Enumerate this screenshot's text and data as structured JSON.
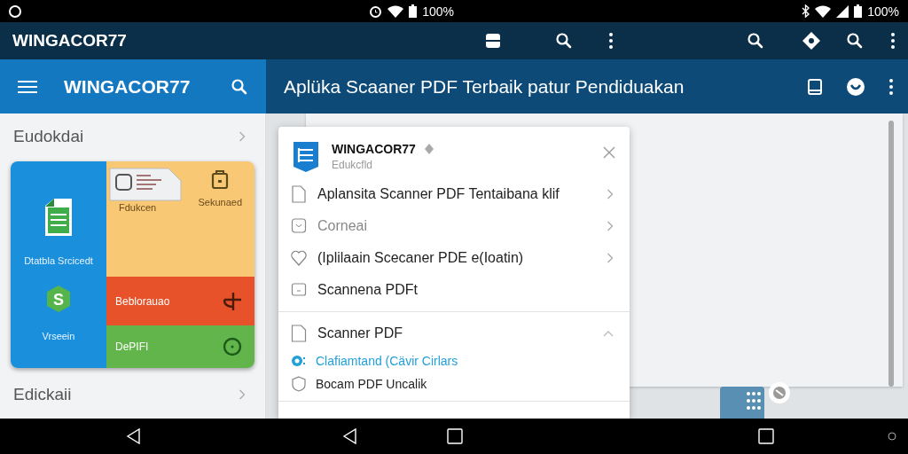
{
  "status_bar": {
    "readings": [
      "100%",
      "100%"
    ]
  },
  "app_bar": {
    "title": "WINGACOR77"
  },
  "toolbar": {
    "drawer_title": "WINGACOR77",
    "page_title": "Aplüka Scaaner PDF Terbaik patur Pendiduakan"
  },
  "sidebar": {
    "sections": [
      {
        "label": "Eudokdai"
      },
      {
        "label": "Edickaii"
      }
    ],
    "tile_card": {
      "left": {
        "color": "#1a8fdc",
        "labels": [
          "Dtatbla Srcicedt",
          "Vrseein"
        ],
        "badge": "S"
      },
      "tiles": [
        {
          "kind": "folder",
          "color": "#f9c874",
          "labels": [
            "Fdukcen",
            "Sekunaed"
          ]
        },
        {
          "kind": "plus",
          "color": "#e8522a",
          "labels": [
            "Beblorauao"
          ]
        },
        {
          "kind": "clock",
          "color": "#62b54a",
          "labels": [
            "DePIFI"
          ]
        }
      ]
    }
  },
  "dialog": {
    "title": "WINGACOR77",
    "subtitle": "Edukcfld",
    "items": [
      {
        "label": "Aplansita Scanner PDF Tentaibana klif",
        "disabled": false
      },
      {
        "label": "Corneai",
        "disabled": true
      },
      {
        "label": "(Iplilaain Scecaner PDE e(Ioatin)",
        "disabled": false
      },
      {
        "label": "Scannena PDFt",
        "disabled": false
      }
    ],
    "section": {
      "label": "Scanner PDF",
      "expanded": true,
      "children": [
        {
          "label": "Clafiamtand (Cävir Cirlars",
          "selected": true
        },
        {
          "label": "Bocam PDF Uncalik",
          "selected": false
        }
      ]
    }
  }
}
